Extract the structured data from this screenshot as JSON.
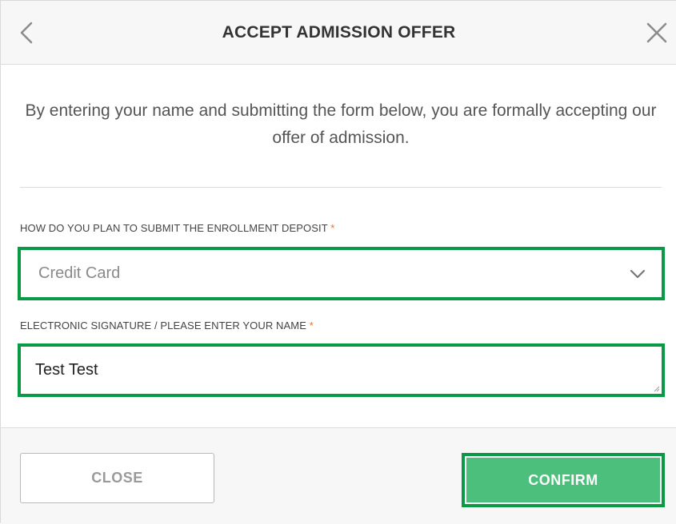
{
  "header": {
    "title": "ACCEPT ADMISSION OFFER",
    "back_icon": "chevron-left-icon",
    "close_icon": "close-icon"
  },
  "intro": {
    "text": "By entering your name and submitting the form below, you are formally accepting our offer of admission."
  },
  "deposit_field": {
    "label": "HOW DO YOU PLAN TO SUBMIT THE ENROLLMENT DEPOSIT",
    "required_marker": "*",
    "selected_value": "Credit Card",
    "icon": "chevron-down-icon"
  },
  "signature_field": {
    "label": "ELECTRONIC SIGNATURE / PLEASE ENTER YOUR NAME",
    "required_marker": "*",
    "value": "Test Test"
  },
  "footer": {
    "close_label": "CLOSE",
    "confirm_label": "CONFIRM"
  },
  "colors": {
    "highlight_border": "#0a9a45",
    "confirm_bg": "#4cbf7c",
    "required": "#e8702a",
    "header_bg": "#f7f7f7"
  }
}
